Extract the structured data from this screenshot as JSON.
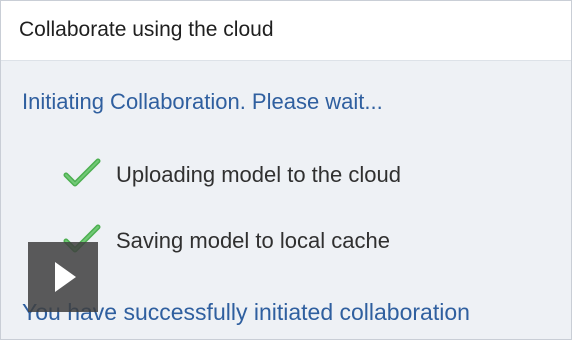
{
  "window": {
    "title": "Collaborate using the cloud"
  },
  "content": {
    "heading": "Initiating Collaboration. Please wait...",
    "steps": [
      {
        "label": "Uploading model to the cloud",
        "icon": "check-icon"
      },
      {
        "label": "Saving model to local cache",
        "icon": "check-icon"
      }
    ],
    "success_message": "You have successfully initiated collaboration"
  },
  "overlay": {
    "icon": "play-icon"
  },
  "colors": {
    "accent": "#2f5f9f",
    "check": "#4caf50",
    "panel": "#eef1f5",
    "overlay": "#404040"
  }
}
